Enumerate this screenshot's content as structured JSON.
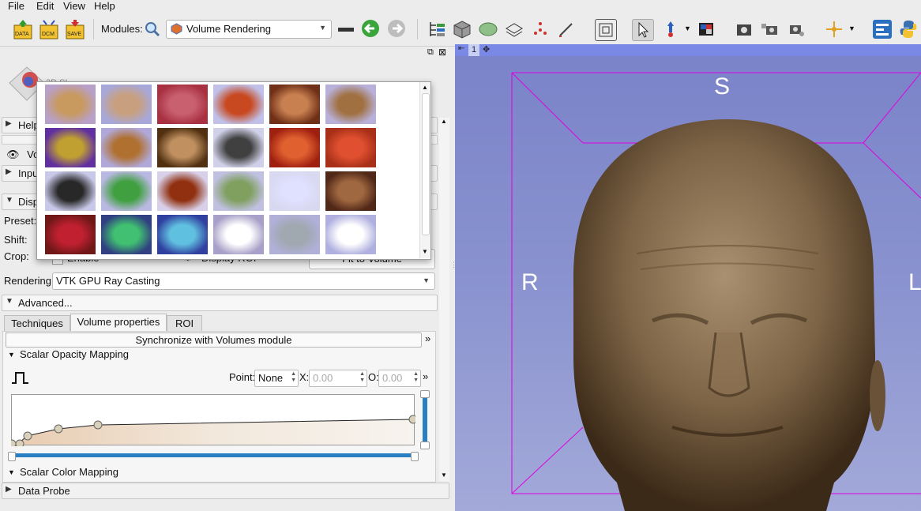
{
  "menu": [
    "File",
    "Edit",
    "View",
    "Help"
  ],
  "toolbar": {
    "data_label": "DATA",
    "dcm_label": "DCM",
    "save_label": "SAVE",
    "modules_label": "Modules:",
    "module_selected": "Volume Rendering"
  },
  "panel": {
    "logo_text": "3D SL",
    "help_label": "Help",
    "volume_label": "Vo",
    "inputs_label": "Inpu",
    "display_label": "Disp",
    "preset_label": "Preset:",
    "shift_label": "Shift:",
    "crop_label": "Crop:",
    "crop_enable": "Enable",
    "display_roi": "Display ROI",
    "fit_to_volume": "Fit to Volume",
    "rendering_label": "Rendering:",
    "rendering_value": "VTK GPU Ray Casting",
    "advanced_label": "Advanced...",
    "tabs": [
      "Techniques",
      "Volume properties",
      "ROI"
    ],
    "sync_label": "Synchronize with Volumes module",
    "scalar_opacity_label": "Scalar Opacity Mapping",
    "point_label": "Point:",
    "point_value": "None",
    "x_label": "X:",
    "x_value": "0.00",
    "o_label": "O:",
    "o_value": "0.00",
    "scalar_color_label": "Scalar Color Mapping",
    "data_probe_label": "Data Probe",
    "expand_glyph": "»"
  },
  "presets": {
    "rows": 4,
    "cols": 6
  },
  "view": {
    "number": "1",
    "orientation": {
      "top": "S",
      "left": "R",
      "right": "L"
    }
  },
  "colors": {
    "view_header": "#7a89e6",
    "roi_box": "#e000e0",
    "accent_blue": "#2a7fc2"
  }
}
